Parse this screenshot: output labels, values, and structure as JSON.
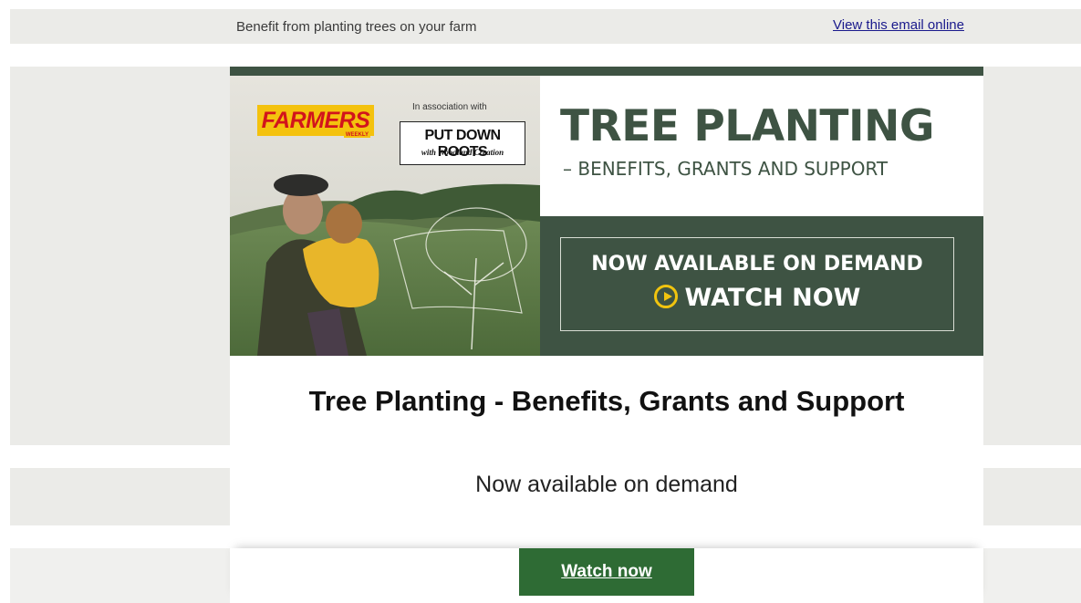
{
  "preheader": {
    "text": "Benefit from planting trees on your farm",
    "view_online": "View this email online"
  },
  "hero": {
    "logo_farmers": "FARMERS",
    "logo_weekly": "WEEKLY",
    "association": "In association with",
    "partner_title": "PUT DOWN ROOTS",
    "partner_sub": "with Woodland Creation",
    "title": "TREE PLANTING",
    "subtitle": "– BENEFITS, GRANTS AND SUPPORT",
    "cta_line1": "NOW AVAILABLE ON DEMAND",
    "cta_line2": "WATCH NOW"
  },
  "body": {
    "headline": "Tree Planting - Benefits, Grants and Support",
    "subline": "Now available on demand",
    "button_label": "Watch now"
  },
  "colors": {
    "brand_green": "#3e5343",
    "button_green": "#2e6b34",
    "accent_yellow": "#f1c40f",
    "farmers_red": "#d2141c"
  }
}
